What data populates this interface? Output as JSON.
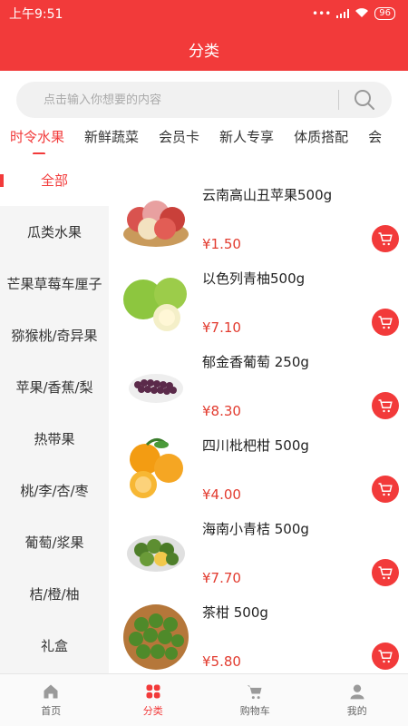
{
  "status": {
    "time": "上午9:51",
    "battery": "96"
  },
  "header": {
    "title": "分类"
  },
  "search": {
    "placeholder": "点击输入你想要的内容"
  },
  "top_tabs": [
    "时令水果",
    "新鲜蔬菜",
    "会员卡",
    "新人专享",
    "体质搭配",
    "会"
  ],
  "side_categories": [
    "全部",
    "瓜类水果",
    "芒果草莓车厘子",
    "猕猴桃/奇异果",
    "苹果/香蕉/梨",
    "热带果",
    "桃/李/杏/枣",
    "葡萄/浆果",
    "桔/橙/柚",
    "礼盒"
  ],
  "products": [
    {
      "name": "云南高山丑苹果500g",
      "price": "¥1.50",
      "image": "apples"
    },
    {
      "name": "以色列青柚500g",
      "price": "¥7.10",
      "image": "green-pomelo"
    },
    {
      "name": "郁金香葡萄 250g",
      "price": "¥8.30",
      "image": "grapes"
    },
    {
      "name": "四川枇杷柑 500g",
      "price": "¥4.00",
      "image": "tangerines"
    },
    {
      "name": "海南小青桔 500g",
      "price": "¥7.70",
      "image": "green-kumquat"
    },
    {
      "name": "茶柑 500g",
      "price": "¥5.80",
      "image": "tea-citrus"
    }
  ],
  "bottom_nav": [
    {
      "label": "首页",
      "icon": "home-icon"
    },
    {
      "label": "分类",
      "icon": "category-icon"
    },
    {
      "label": "购物车",
      "icon": "cart-icon"
    },
    {
      "label": "我的",
      "icon": "user-icon"
    }
  ],
  "colors": {
    "accent": "#f23a3a",
    "price": "#e23b2f"
  }
}
